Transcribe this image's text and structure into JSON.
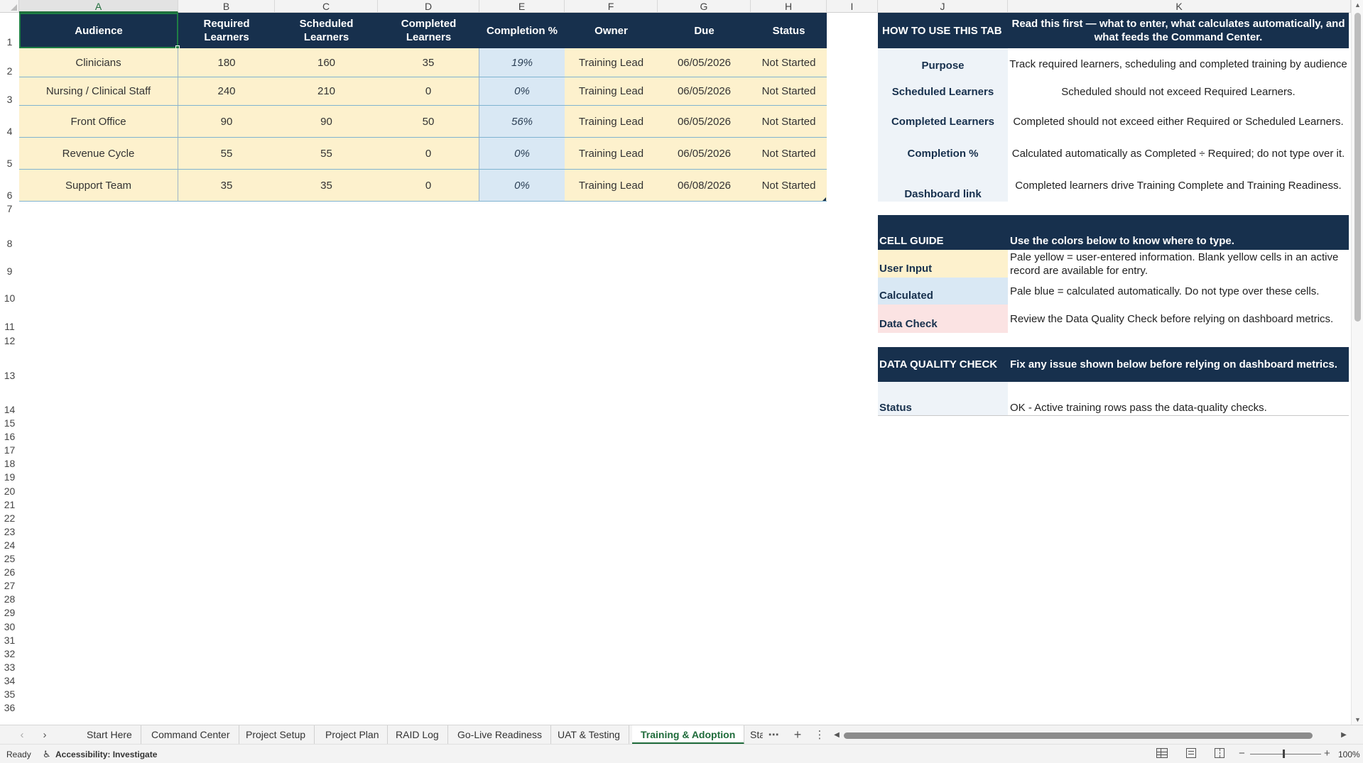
{
  "sheet": {
    "columns": [
      "A",
      "B",
      "C",
      "D",
      "E",
      "F",
      "G",
      "H",
      "I",
      "J",
      "K"
    ],
    "row_numbers": [
      "1",
      "2",
      "3",
      "4",
      "5",
      "6",
      "7",
      "8",
      "9",
      "10",
      "11",
      "12",
      "13",
      "14",
      "15",
      "16",
      "17",
      "18",
      "19",
      "20",
      "21",
      "22",
      "23",
      "24",
      "25",
      "26",
      "27",
      "28",
      "29",
      "30",
      "31",
      "32",
      "33",
      "34",
      "35",
      "36"
    ],
    "table": {
      "headers": [
        "Audience",
        "Required Learners",
        "Scheduled Learners",
        "Completed Learners",
        "Completion %",
        "Owner",
        "Due",
        "Status"
      ],
      "rows": [
        [
          "Clinicians",
          "180",
          "160",
          "35",
          "19%",
          "Training Lead",
          "06/05/2026",
          "Not Started"
        ],
        [
          "Nursing / Clinical Staff",
          "240",
          "210",
          "0",
          "0%",
          "Training Lead",
          "06/05/2026",
          "Not Started"
        ],
        [
          "Front Office",
          "90",
          "90",
          "50",
          "56%",
          "Training Lead",
          "06/05/2026",
          "Not Started"
        ],
        [
          "Revenue Cycle",
          "55",
          "55",
          "0",
          "0%",
          "Training Lead",
          "06/05/2026",
          "Not Started"
        ],
        [
          "Support Team",
          "35",
          "35",
          "0",
          "0%",
          "Training Lead",
          "06/08/2026",
          "Not Started"
        ]
      ]
    },
    "how_to": {
      "title": "HOW TO USE THIS TAB",
      "subtitle": "Read this first — what to enter, what calculates automatically, and what feeds the Command Center.",
      "items": [
        {
          "label": "Purpose",
          "text": "Track required learners, scheduling and completed training by audience"
        },
        {
          "label": "Scheduled Learners",
          "text": "Scheduled should not exceed Required Learners."
        },
        {
          "label": "Completed Learners",
          "text": "Completed should not exceed either Required or Scheduled Learners."
        },
        {
          "label": "Completion %",
          "text": "Calculated automatically as Completed ÷ Required; do not type over it."
        },
        {
          "label": "Dashboard link",
          "text": "Completed learners drive Training Complete and Training Readiness."
        }
      ]
    },
    "cell_guide": {
      "title": "CELL GUIDE",
      "subtitle": "Use the colors below to know where to type.",
      "items": [
        {
          "label": "User Input",
          "text": "Pale yellow = user-entered information. Blank yellow cells in an active record are available for entry.",
          "color": "#fdf1cd"
        },
        {
          "label": "Calculated",
          "text": "Pale blue = calculated automatically. Do not type over these cells.",
          "color": "#d9e8f4"
        },
        {
          "label": "Data Check",
          "text": "Review the Data Quality Check before relying on dashboard metrics.",
          "color": "#fbe3e3"
        }
      ]
    },
    "data_quality": {
      "title": "DATA QUALITY CHECK",
      "subtitle": "Fix any issue shown below before relying on dashboard metrics.",
      "label": "Status",
      "text": "OK - Active training rows pass the data-quality checks."
    }
  },
  "tabs": [
    "Start Here",
    "Command Center",
    "Project Setup",
    "Project Plan",
    "RAID Log",
    "Go-Live Readiness",
    "UAT & Testing",
    "Training & Adoption",
    "Sta"
  ],
  "active_tab": "Training & Adoption",
  "status": {
    "ready": "Ready",
    "accessibility": "Accessibility: Investigate",
    "zoom": "100%"
  },
  "colors": {
    "header": "#17304d",
    "user_input": "#fdf1cd",
    "calculated": "#d9e8f4",
    "data_check": "#fbe3e3",
    "accent": "#1e6b3a"
  },
  "icons": [
    "prev-sheet-icon",
    "next-sheet-icon",
    "more-sheets-icon",
    "add-sheet-icon",
    "sheet-options-icon",
    "accessibility-icon",
    "normal-view-icon",
    "page-layout-icon",
    "page-break-icon",
    "zoom-out-icon",
    "zoom-in-icon"
  ]
}
